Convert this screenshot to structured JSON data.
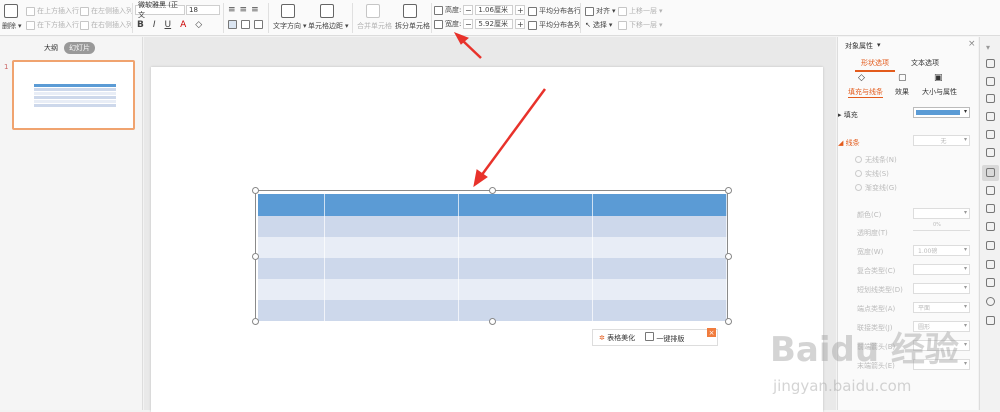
{
  "ribbon": {
    "delete": "删除",
    "insert_above": "在上方插入行",
    "insert_below": "在下方插入行",
    "insert_left": "在左侧插入列",
    "insert_right": "在右侧插入列",
    "font_name": "微软雅黑 (正文",
    "font_size": "18",
    "text_direction": "文字方向",
    "cell_margin": "单元格边距",
    "merge_cells": "合并单元格",
    "split_cells": "拆分单元格",
    "height_label": "高度:",
    "height_value": "1.06厘米",
    "width_label": "宽度:",
    "width_value": "5.92厘米",
    "dist_rows": "平均分布各行",
    "dist_cols": "平均分布各列",
    "align": "对齐",
    "select": "选择",
    "bring_forward": "上移一层",
    "send_backward": "下移一层",
    "minus": "−",
    "plus": "+"
  },
  "left_panel": {
    "tab_outline": "大纲",
    "tab_slides": "幻灯片",
    "slide_number": "1"
  },
  "table_tools": {
    "beautify": "表格美化",
    "one_click": "一键排版",
    "close": "×"
  },
  "props": {
    "title": "对象属性",
    "tab_shape": "形状选项",
    "tab_text": "文本选项",
    "sub_fill_line": "填充与线条",
    "sub_effect": "效果",
    "sub_size": "大小与属性",
    "fill": "填充",
    "line": "线条",
    "line_value": "无",
    "no_line": "无线条(N)",
    "solid_line": "实线(S)",
    "gradient_line": "渐变线(G)",
    "color": "颜色(C)",
    "transparency": "透明度(T)",
    "transparency_value": "0%",
    "width": "宽度(W)",
    "width_value": "1.00磅",
    "compound": "复合类型(C)",
    "dash": "短划线类型(D)",
    "cap": "端点类型(A)",
    "cap_value": "平面",
    "join": "联接类型(J)",
    "join_value": "圆形",
    "arrow_head": "前端箭头(B)",
    "arrow_tail": "末端箭头(E)",
    "close": "×"
  },
  "colors": {
    "header": "#5b9bd5",
    "row_dark": "#cdd8eb",
    "row_light": "#e8edf6",
    "accent": "#e35b1c",
    "arrow": "#e8322b"
  },
  "watermark": {
    "main": "Baidu 经验",
    "sub": "jingyan.baidu.com"
  }
}
